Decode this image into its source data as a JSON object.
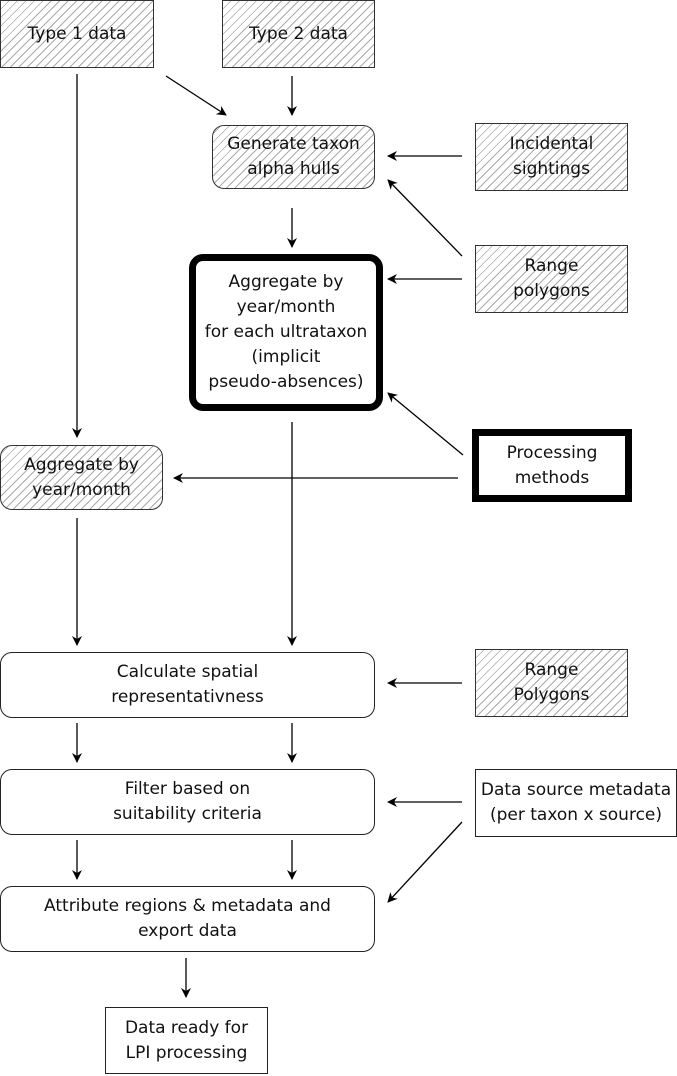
{
  "diagram": {
    "nodes": {
      "type1": "Type 1 data",
      "type2": "Type 2 data",
      "alpha_hulls": "Generate taxon\nalpha hulls",
      "incidental": "Incidental\nsightings",
      "range1": "Range\npolygons",
      "aggregate_ultra": "Aggregate by\nyear/month\nfor each ultrataxon\n(implicit\npseudo-absences)",
      "processing": "Processing\nmethods",
      "aggregate": "Aggregate by\nyear/month",
      "spatial": "Calculate spatial\nrepresentativness",
      "range2": "Range\nPolygons",
      "filter": "Filter based on\nsuitability criteria",
      "metadata": "Data source metadata\n(per taxon x source)",
      "attribute": "Attribute regions & metadata and\nexport data",
      "ready": "Data ready for\nLPI processing"
    }
  }
}
